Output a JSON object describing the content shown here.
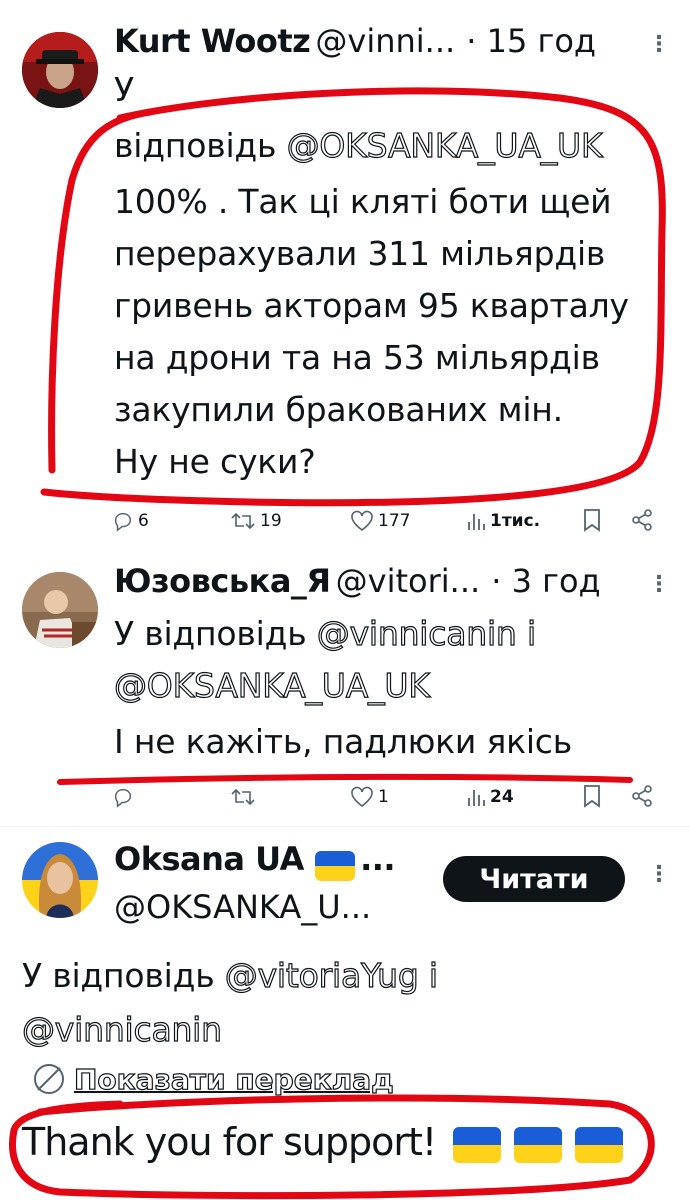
{
  "tweets": [
    {
      "name": "Kurt Wootz",
      "handle": "@vinni...",
      "time": "· 15 год",
      "reply_prefix_line1": "У",
      "reply_prefix_line2": "відповідь",
      "mention": "@OKSANKA_UA_UK",
      "body_lines": [
        "100% . Так ці кляті боти щей",
        "перерахували 311 мільярдів",
        "гривень акторам 95 кварталу",
        "на дрони та на 53 мільярдів",
        "закупили бракованих мін.",
        "Ну не суки?"
      ],
      "replies": "6",
      "reposts": "19",
      "likes": "177",
      "views": "1тис."
    },
    {
      "name": "Юзовська_Я",
      "handle": "@vitori...",
      "time": "· 3 год",
      "reply_prefix": "У відповідь",
      "mention1": "@vinnicanin",
      "conj": "і",
      "mention2": "@OKSANKA_UA_UK",
      "body": "І не кажіть, падлюки якісь",
      "replies": "",
      "reposts": "",
      "likes": "1",
      "views": "24"
    },
    {
      "name": "Oksana UA",
      "name_suffix": "...",
      "handle": "@OKSANKA_U...",
      "follow_label": "Читати",
      "reply_prefix": "У відповідь",
      "mention1": "@vitoriaYug",
      "conj": "і",
      "mention2": "@vinnicanin",
      "translate_label": "Показати переклад",
      "body": "Thank you for support!"
    }
  ],
  "more_icon": "more-dots-icon",
  "colors": {
    "marker": "#e30613",
    "text": "#0f1419",
    "muted": "#536471",
    "flag_blue": "#1a5dd8",
    "flag_yellow": "#ffd21a"
  }
}
